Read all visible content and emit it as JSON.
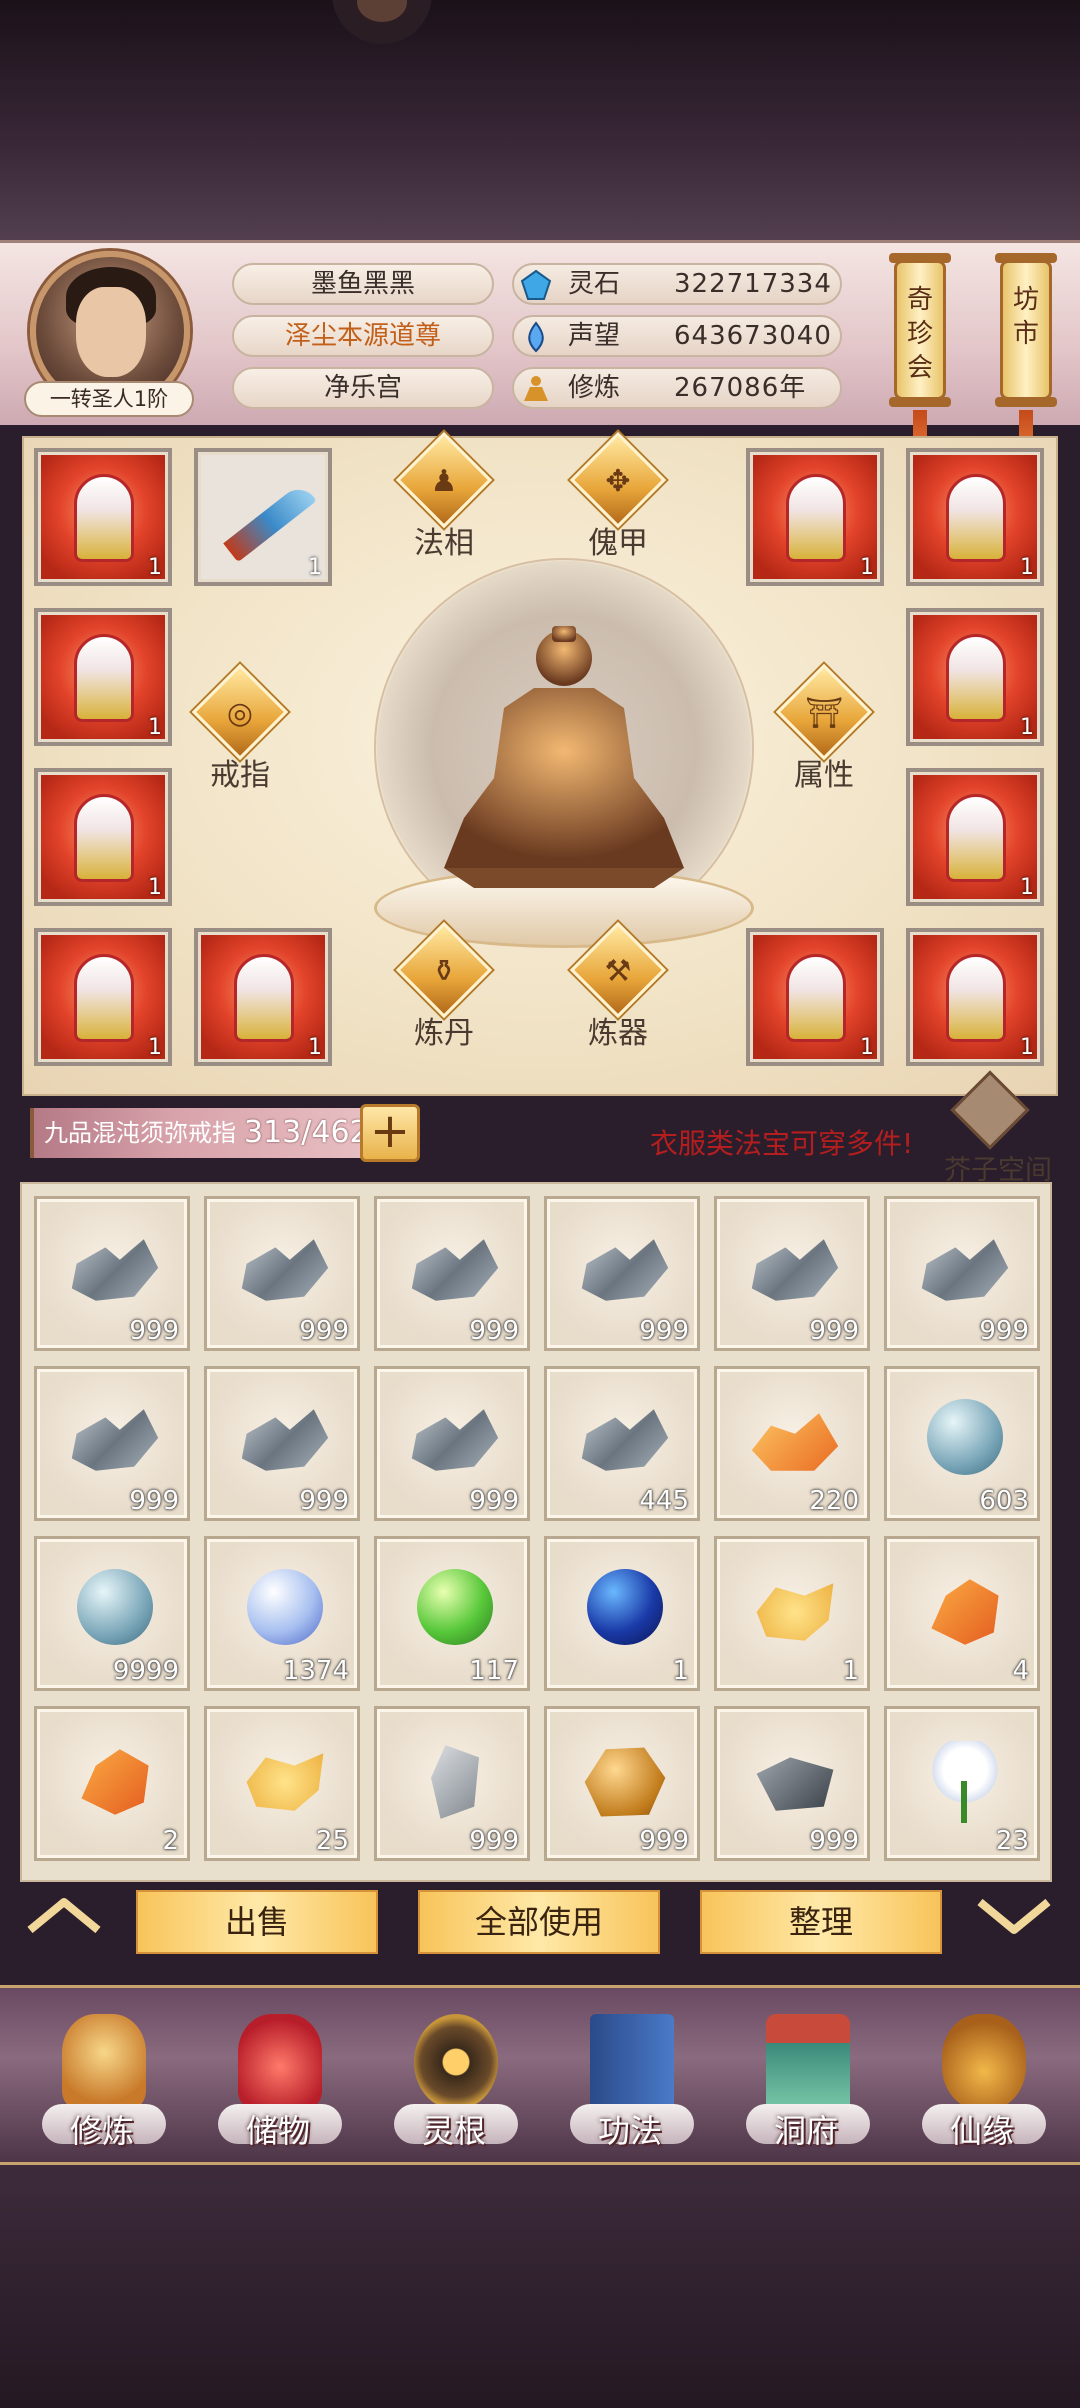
{
  "header": {
    "rank": "一转圣人1阶",
    "name": "墨鱼黑黑",
    "title": "泽尘本源道尊",
    "sect": "净乐宫",
    "resources": [
      {
        "icon": "spirit-stone-icon",
        "label": "灵石",
        "value": "322717334"
      },
      {
        "icon": "reputation-icon",
        "label": "声望",
        "value": "643673040"
      },
      {
        "icon": "cultivation-icon",
        "label": "修炼",
        "value": "267086年"
      }
    ],
    "scroll_left": "奇珍会",
    "scroll_right": "坊市"
  },
  "equip": {
    "slot_count": "1",
    "labels": {
      "faxiang": "法相",
      "kuijia": "傀甲",
      "jiezhi": "戒指",
      "shuxing": "属性",
      "liandan": "炼丹",
      "lianqi": "炼器"
    }
  },
  "capacity": {
    "ring_name": "九品混沌须弥戒指",
    "count": "313/462",
    "plus": "+",
    "note": "衣服类法宝可穿多件!",
    "space_label": "芥子空间"
  },
  "bag": {
    "items": [
      {
        "kind": "ore",
        "count": "999"
      },
      {
        "kind": "ore",
        "count": "999"
      },
      {
        "kind": "ore",
        "count": "999"
      },
      {
        "kind": "ore",
        "count": "999"
      },
      {
        "kind": "ore",
        "count": "999"
      },
      {
        "kind": "ore",
        "count": "999"
      },
      {
        "kind": "ore",
        "count": "999"
      },
      {
        "kind": "ore",
        "count": "999"
      },
      {
        "kind": "ore",
        "count": "999"
      },
      {
        "kind": "ore",
        "count": "445"
      },
      {
        "kind": "gold",
        "count": "220"
      },
      {
        "kind": "orb",
        "count": "603"
      },
      {
        "kind": "orb",
        "count": "9999"
      },
      {
        "kind": "orb blue",
        "count": "1374"
      },
      {
        "kind": "orb green",
        "count": "117"
      },
      {
        "kind": "orb dark",
        "count": "1"
      },
      {
        "kind": "swirl",
        "count": "1"
      },
      {
        "kind": "flame",
        "count": "4"
      },
      {
        "kind": "flame",
        "count": "2"
      },
      {
        "kind": "swirl",
        "count": "25"
      },
      {
        "kind": "stone",
        "count": "999"
      },
      {
        "kind": "nug",
        "count": "999"
      },
      {
        "kind": "rock",
        "count": "999"
      },
      {
        "kind": "flower",
        "count": "23"
      }
    ]
  },
  "actions": {
    "sell": "出售",
    "use_all": "全部使用",
    "sort": "整理"
  },
  "nav": [
    {
      "label": "修炼",
      "icon": "cultivate-icon"
    },
    {
      "label": "储物",
      "icon": "storage-bag-icon"
    },
    {
      "label": "灵根",
      "icon": "spirit-root-icon"
    },
    {
      "label": "功法",
      "icon": "technique-book-icon"
    },
    {
      "label": "洞府",
      "icon": "cave-dwelling-icon"
    },
    {
      "label": "仙缘",
      "icon": "gourd-icon"
    }
  ],
  "colors": {
    "accent_gold": "#f8c45a",
    "warning_red": "#b51e1e",
    "title_orange": "#c2601a"
  }
}
